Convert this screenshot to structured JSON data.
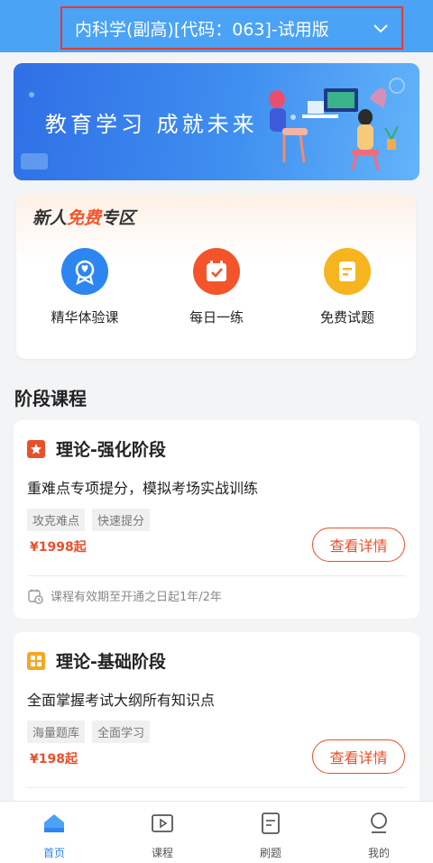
{
  "header": {
    "subject_label": "内科学(副高)[代码：063]-试用版"
  },
  "banner": {
    "slogan": "教育学习 成就未来"
  },
  "new_user_zone": {
    "title_prefix": "新人",
    "title_highlight": "免费",
    "title_suffix": "专区",
    "items": [
      {
        "label": "精华体验课",
        "icon": "badge-icon",
        "color": "#2d86f0"
      },
      {
        "label": "每日一练",
        "icon": "calendar-check-icon",
        "color": "#f5542a"
      },
      {
        "label": "免费试题",
        "icon": "document-icon",
        "color": "#f6b51e"
      }
    ]
  },
  "section": {
    "title": "阶段课程"
  },
  "courses": [
    {
      "title": "理论-强化阶段",
      "icon": "star-icon",
      "icon_color": "#e8502c",
      "description": "重难点专项提分，模拟考场实战训练",
      "tags": [
        "攻克难点",
        "快速提分"
      ],
      "price": "¥1998起",
      "button_label": "查看详情",
      "validity": "课程有效期至开通之日起1年/2年"
    },
    {
      "title": "理论-基础阶段",
      "icon": "grid-icon",
      "icon_color": "#f6a623",
      "description": "全面掌握考试大纲所有知识点",
      "tags": [
        "海量题库",
        "全面学习"
      ],
      "price": "¥198起",
      "button_label": "查看详情"
    }
  ],
  "tabbar": {
    "items": [
      {
        "label": "首页",
        "icon": "home-icon",
        "active": true
      },
      {
        "label": "课程",
        "icon": "play-icon",
        "active": false
      },
      {
        "label": "刷题",
        "icon": "paper-icon",
        "active": false
      },
      {
        "label": "我的",
        "icon": "user-icon",
        "active": false
      }
    ]
  },
  "colors": {
    "primary": "#4aa3f5",
    "accent": "#e8502c",
    "active_tab": "#2d86f0"
  }
}
